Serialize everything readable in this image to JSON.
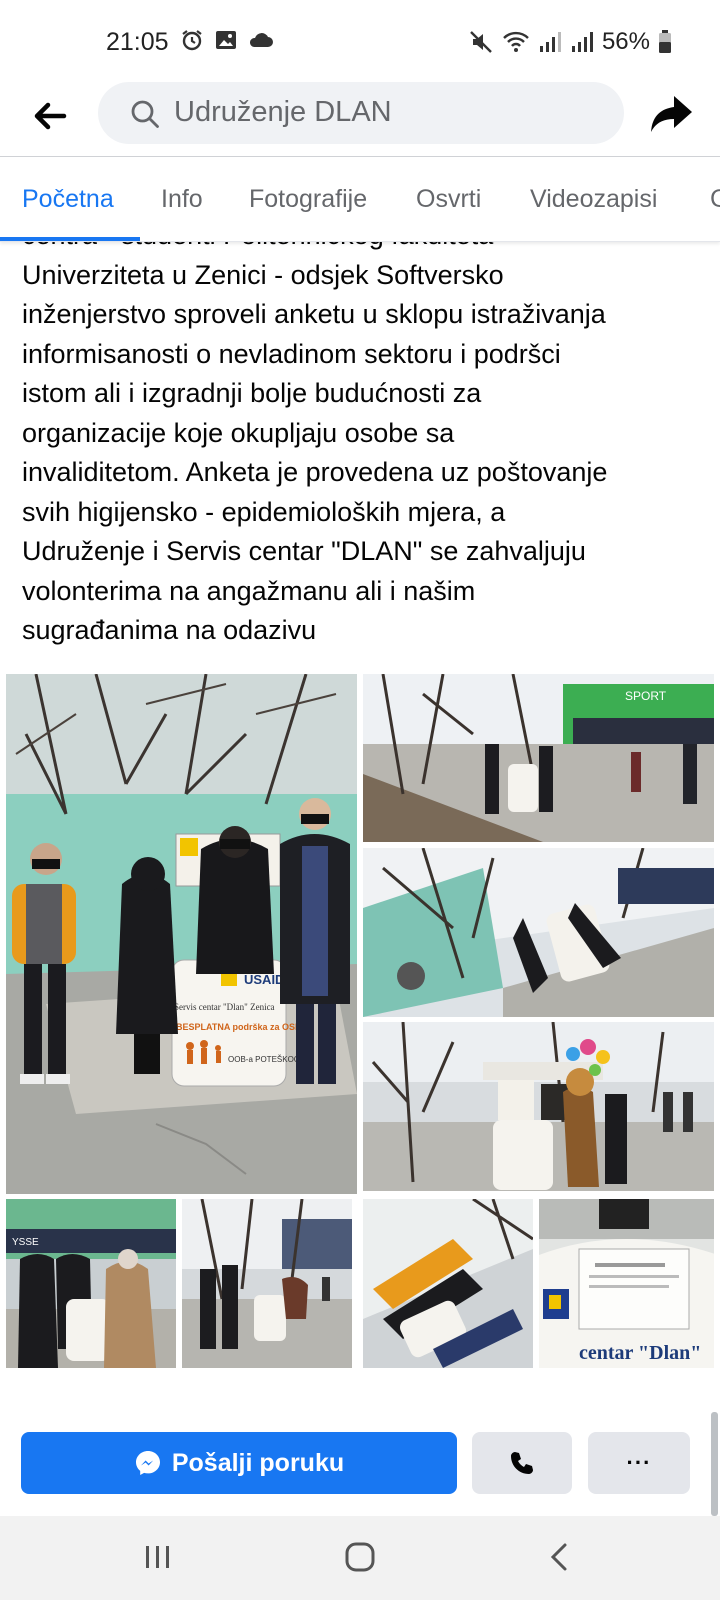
{
  "status_bar": {
    "time": "21:05",
    "battery": "56%",
    "left_icons": [
      "alarm-icon",
      "image-icon",
      "cloud-icon"
    ],
    "right_icons": [
      "mute-icon",
      "wifi-icon",
      "signal-icon",
      "signal-icon",
      "battery-icon"
    ]
  },
  "top_bar": {
    "search_text": "Udruženje DLAN",
    "back_icon": "arrow-left-icon",
    "share_icon": "share-arrow-icon"
  },
  "tabs": [
    {
      "label": "Početna",
      "active": true
    },
    {
      "label": "Info"
    },
    {
      "label": "Fotografije"
    },
    {
      "label": "Osvrti"
    },
    {
      "label": "Videozapisi"
    },
    {
      "label": "C"
    }
  ],
  "post": {
    "lines": [
      "centra - studenti Politehničkog fakulteta",
      "Univerziteta u Zenici - odsjek Softversko",
      "inženjerstvo sproveli anketu u sklopu istraživanja",
      "informisanosti o nevladinom sektoru i podršci",
      "istom ali i izgradnji bolje budućnosti za",
      "organizacije koje okupljaju osobe sa",
      "invaliditetom. Anketa je provedena uz poštovanje",
      "svih higijensko - epidemioloških mjera, a",
      "Udruženje i Servis centar \"DLAN\" se zahvaljuju",
      "volonterima na angažmanu ali i našim",
      "sugrađanima na odazivu"
    ]
  },
  "photo_texts": {
    "usaid": "USAID",
    "servis": "Servis centar \"Dlan\" Zenica",
    "besplatna": "BESPLATNA podrška za OSI",
    "poteskoce": "OOB-a POTEŠKOĆE",
    "sport": "SPORT",
    "ysse": "YSSE"
  },
  "actions": {
    "message_label": "Pošalji poruku",
    "more_label": "···"
  },
  "colors": {
    "accent": "#1877f2",
    "text": "#050505",
    "muted": "#65676b",
    "button_gray": "#e4e6eb"
  }
}
